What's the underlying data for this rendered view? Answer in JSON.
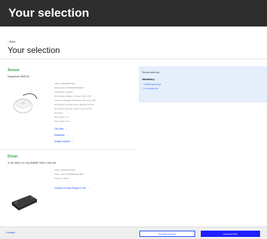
{
  "header": {
    "title": "Your selection"
  },
  "nav": {
    "back_label": "‹ Back"
  },
  "page": {
    "title": "Your selection"
  },
  "sensor": {
    "label": "Sensor",
    "name": "Easysense SNS210",
    "specs": [
      "12NC: 929002807208",
      "Order code: 871869675450400",
      "Application: Industry",
      "Technology: Zigbee, Infrared, NFC, PIR",
      "Features: Daylight harvesting, Dimming, PIR",
      "and higher luminaire-level Lighting Control,",
      "Occupancy sensing, Task tuning, Zoning",
      "Grouping",
      "Min height: 1 m",
      "Max height: 14 m"
    ],
    "links": [
      "CAD files",
      "Datasheet",
      "Design-in guide"
    ]
  },
  "addons": {
    "title": "Sensor add-ons",
    "subtitle": "Mandatory",
    "items": [
      "✓ Philips Field Apps",
      "✓ in Dongle v2.0"
    ]
  },
  "driver": {
    "label": "Driver",
    "name": "Xi SR 40W 0.3-1.0A SNEMP 230V C103 sXt",
    "specs": [
      "12NC: 929001767408",
      "Order code: 871869976910600",
      "Family: Outdoor"
    ],
    "links": [
      "Continue in Easy Design-in Tool"
    ]
  },
  "footer": {
    "restart_label": "‹ Restart",
    "purchase_label": "Purchase samples",
    "download_label": "Download PDF"
  },
  "icons": {
    "arrow": "→"
  },
  "colors": {
    "header_bg": "#2d2d2d",
    "accent_green": "#2aa34a",
    "link_blue": "#1f4fff",
    "panel_bg": "#e5eefb"
  }
}
